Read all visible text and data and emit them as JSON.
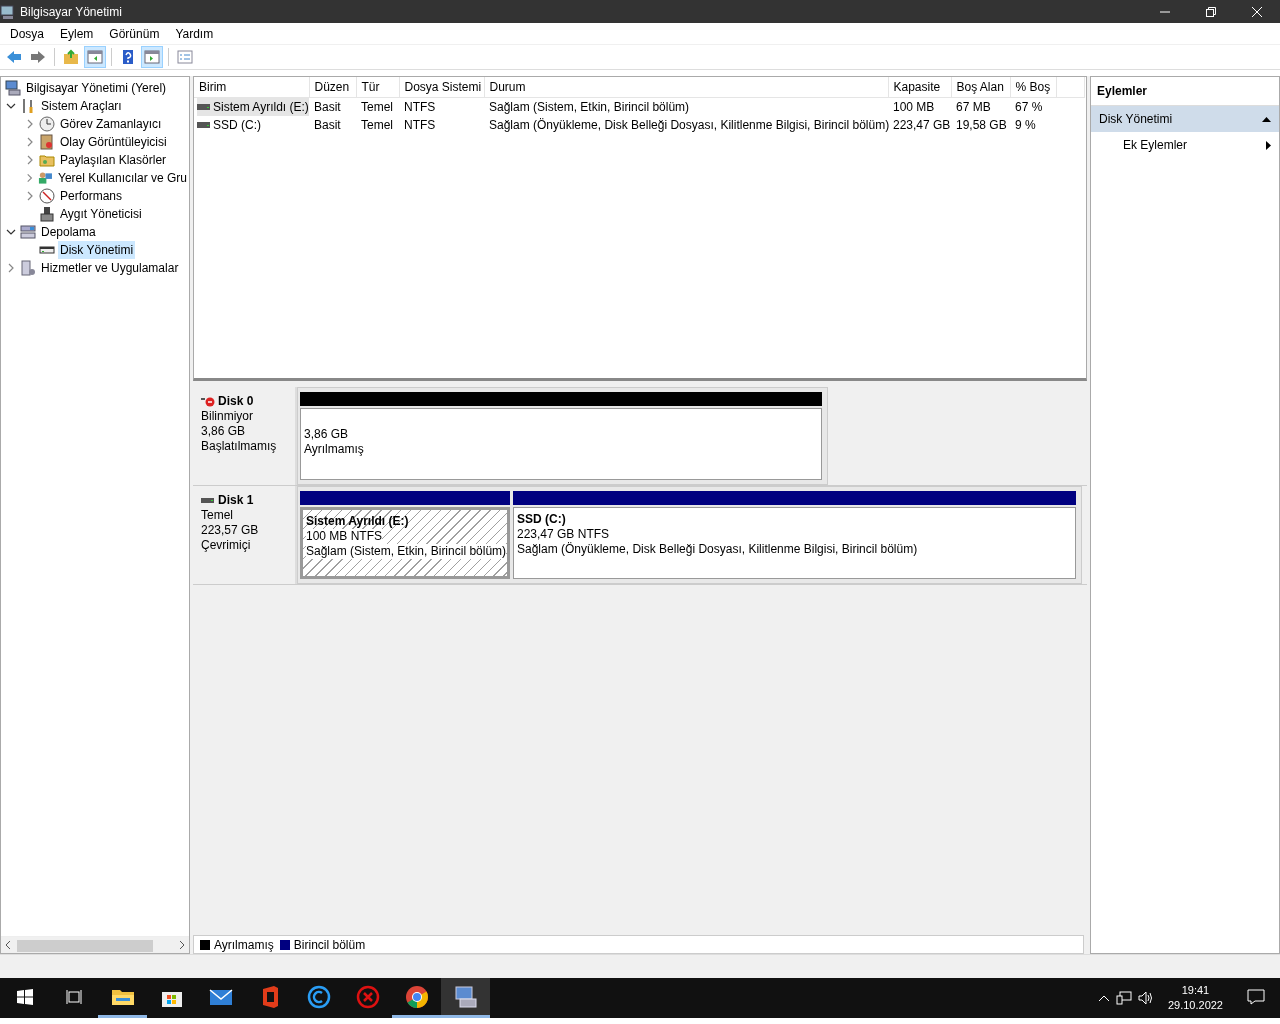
{
  "window": {
    "title": "Bilgisayar Yönetimi"
  },
  "menu": [
    "Dosya",
    "Eylem",
    "Görünüm",
    "Yardım"
  ],
  "toolbar": [
    {
      "kind": "back",
      "pressed": false
    },
    {
      "kind": "forward",
      "pressed": false
    },
    {
      "kind": "up",
      "pressed": false
    },
    {
      "kind": "console-tree",
      "pressed": true
    },
    {
      "kind": "help",
      "pressed": false
    },
    {
      "kind": "action-pane",
      "pressed": true
    },
    {
      "kind": "properties",
      "pressed": false
    }
  ],
  "tree": [
    {
      "label": "Bilgisayar Yönetimi (Yerel)",
      "kind": "computer",
      "selected": false,
      "children": [
        {
          "label": "Sistem Araçları",
          "kind": "tools",
          "expanded": true,
          "selected": false,
          "children": [
            {
              "label": "Görev Zamanlayıcı",
              "kind": "clock",
              "expanded": false,
              "selected": false
            },
            {
              "label": "Olay Görüntüleyicisi",
              "kind": "log",
              "expanded": false,
              "selected": false
            },
            {
              "label": "Paylaşılan Klasörler",
              "kind": "folder",
              "expanded": false,
              "selected": false
            },
            {
              "label": "Yerel Kullanıcılar ve Gru",
              "kind": "users",
              "expanded": false,
              "selected": false
            },
            {
              "label": "Performans",
              "kind": "gauge",
              "expanded": false,
              "selected": false
            },
            {
              "label": "Aygıt Yöneticisi",
              "kind": "device",
              "selected": false
            }
          ]
        },
        {
          "label": "Depolama",
          "kind": "storage",
          "expanded": true,
          "selected": false,
          "children": [
            {
              "label": "Disk Yönetimi",
              "kind": "disk",
              "selected": true
            }
          ]
        },
        {
          "label": "Hizmetler ve Uygulamalar",
          "kind": "services",
          "expanded": false,
          "selected": false
        }
      ]
    }
  ],
  "volumes": {
    "columns": [
      "Birim",
      "Düzen",
      "Tür",
      "Dosya Sistemi",
      "Durum",
      "Kapasite",
      "Boş Alan",
      "% Boş"
    ],
    "rows": [
      {
        "selected": true,
        "cells": [
          "Sistem Ayrıldı (E:)",
          "Basit",
          "Temel",
          "NTFS",
          "Sağlam (Sistem, Etkin, Birincil bölüm)",
          "100 MB",
          "67 MB",
          "67 %"
        ]
      },
      {
        "selected": false,
        "cells": [
          "SSD (C:)",
          "Basit",
          "Temel",
          "NTFS",
          "Sağlam (Önyükleme, Disk Belleği Dosyası, Kilitlenme Bilgisi, Birincil bölüm)",
          "223,47 GB",
          "19,58 GB",
          "9 %"
        ]
      }
    ]
  },
  "disks": [
    {
      "name": "Disk 0",
      "kind": "unknown",
      "lines": [
        "Bilinmiyor",
        "3,86 GB",
        "Başlatılmamış"
      ],
      "partitions": [
        {
          "kind": "unallocated",
          "selected": false,
          "lines": [
            "3,86 GB",
            "Ayrılmamış"
          ]
        }
      ]
    },
    {
      "name": "Disk 1",
      "kind": "basic",
      "lines": [
        "Temel",
        "223,57 GB",
        "Çevrimiçi"
      ],
      "partitions": [
        {
          "kind": "primary",
          "selected": true,
          "title": "Sistem Ayrıldı  (E:)",
          "lines": [
            "100 MB NTFS",
            "Sağlam (Sistem, Etkin, Birincil bölüm)"
          ]
        },
        {
          "kind": "primary",
          "selected": false,
          "title": "SSD  (C:)",
          "lines": [
            "223,47 GB NTFS",
            "Sağlam (Önyükleme, Disk Belleği Dosyası, Kilitlenme Bilgisi, Birincil bölüm)"
          ]
        }
      ]
    }
  ],
  "legend": [
    {
      "label": "Ayrılmamış",
      "color": "#000000"
    },
    {
      "label": "Birincil bölüm",
      "color": "#000080"
    }
  ],
  "actions": {
    "title": "Eylemler",
    "section": {
      "label": "Disk Yönetimi",
      "expanded": true
    },
    "items": [
      "Ek Eylemler"
    ]
  },
  "taskbar": {
    "apps": [
      {
        "kind": "explorer",
        "running": true,
        "selected": false
      },
      {
        "kind": "store",
        "running": false,
        "selected": false
      },
      {
        "kind": "mail",
        "running": false,
        "selected": false
      },
      {
        "kind": "office",
        "running": false,
        "selected": false
      },
      {
        "kind": "ccleaner",
        "running": false,
        "selected": false
      },
      {
        "kind": "antivirus",
        "running": false,
        "selected": false
      },
      {
        "kind": "chrome",
        "running": true,
        "selected": false
      },
      {
        "kind": "compmgmt",
        "running": true,
        "selected": true
      }
    ],
    "time": "19:41",
    "date": "29.10.2022"
  }
}
